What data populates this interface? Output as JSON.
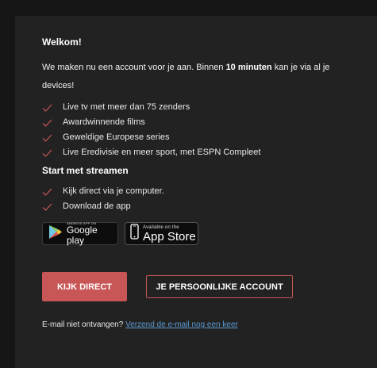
{
  "welcome": {
    "title": "Welkom!"
  },
  "intro": {
    "before": "We maken nu een account voor je aan. Binnen ",
    "bold": "10 minuten",
    "after": " kan je via al je devices!"
  },
  "features": [
    "Live tv met meer dan 75 zenders",
    "Awardwinnende films",
    "Geweldige Europese series",
    "Live Eredivisie en meer sport, met ESPN Compleet"
  ],
  "streaming": {
    "title": "Start met streamen",
    "items": [
      "Kijk direct via je computer.",
      "Download de app"
    ]
  },
  "badges": {
    "google": {
      "small": "ANDROID APP ON",
      "large": "Google play"
    },
    "apple": {
      "small": "Available on the",
      "large": "App Store"
    }
  },
  "buttons": {
    "primary": "KIJK DIRECT",
    "secondary": "JE PERSOONLIJKE ACCOUNT"
  },
  "resend": {
    "text": "E-mail niet ontvangen? ",
    "link": "Verzend de e-mail nog een keer"
  },
  "colors": {
    "accent": "#c85656",
    "link": "#5b9bd5",
    "background": "#161616",
    "card": "#222222"
  }
}
